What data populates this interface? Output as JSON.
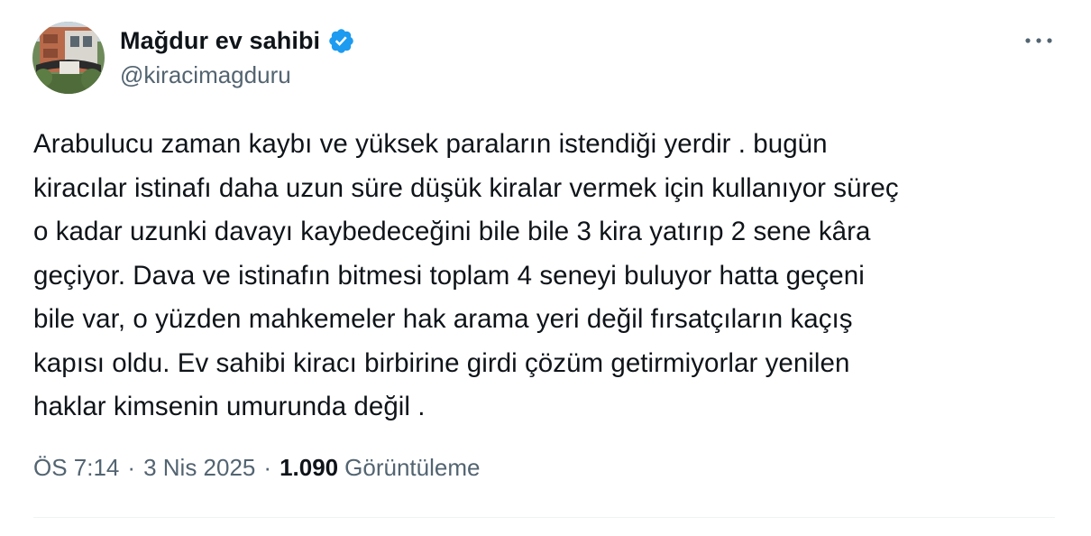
{
  "author": {
    "display_name": "Mağdur ev sahibi",
    "handle": "@kiracimagduru",
    "verified_icon": "verified-badge-icon",
    "verified_color": "#1d9bf0"
  },
  "menu": {
    "icon": "more-horizontal-icon"
  },
  "tweet": {
    "text": "Arabulucu zaman kaybı ve yüksek paraların istendiği yerdir . bugün\nkiracılar istinafı daha uzun süre düşük kiralar vermek için kullanıyor süreç\no kadar uzunki davayı kaybedeceğini bile bile 3 kira yatırıp 2 sene kâra\ngeçiyor. Dava ve istinafın bitmesi toplam 4 seneyi buluyor hatta geçeni\nbile var, o yüzden mahkemeler hak arama yeri değil fırsatçıların kaçış\nkapısı oldu. Ev sahibi kiracı birbirine girdi çözüm getirmiyorlar yenilen\nhaklar kimsenin umurunda değil ."
  },
  "meta": {
    "time": "ÖS 7:14",
    "separator": "·",
    "date": "3 Nis 2025",
    "views_count": "1.090",
    "views_label": "Görüntüleme"
  },
  "colors": {
    "text_primary": "#0f1419",
    "text_secondary": "#536471",
    "divider": "#eff3f4"
  }
}
